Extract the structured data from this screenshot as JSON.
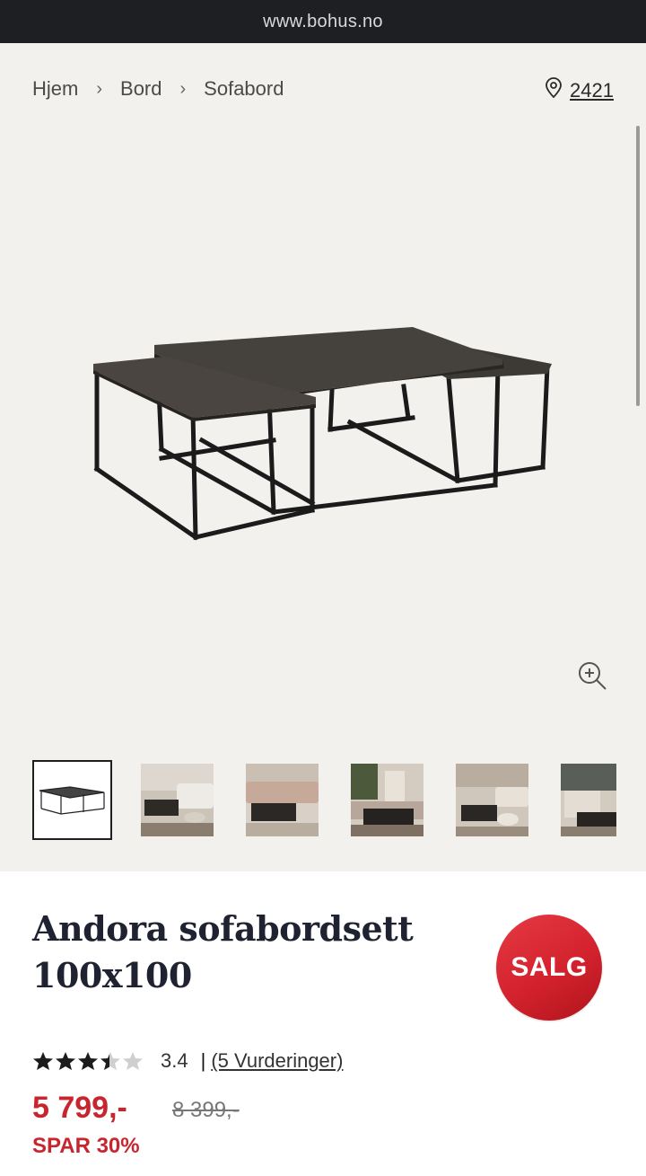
{
  "browser": {
    "url": "www.bohus.no"
  },
  "breadcrumb": {
    "items": [
      "Hjem",
      "Bord",
      "Sofabord"
    ],
    "separator": "›"
  },
  "store": {
    "icon": "location-pin-icon",
    "label": "2421"
  },
  "gallery": {
    "zoom_icon": "zoom-in-icon",
    "thumbnail_count": 6,
    "selected_index": 0
  },
  "product": {
    "title_line1": "Andora sofabordsett",
    "title_line2": "100x100",
    "badge": "SALG",
    "rating_value": 3.4,
    "rating_text": "3.4",
    "rating_pipe": "|",
    "reviews": "(5 Vurderinger)",
    "price": "5 799,-",
    "old_price": "8 399,-",
    "save": "SPAR 30%"
  },
  "colors": {
    "sale_red": "#c8262f",
    "title_navy": "#1f2230",
    "page_bg": "#f3f1ee"
  }
}
